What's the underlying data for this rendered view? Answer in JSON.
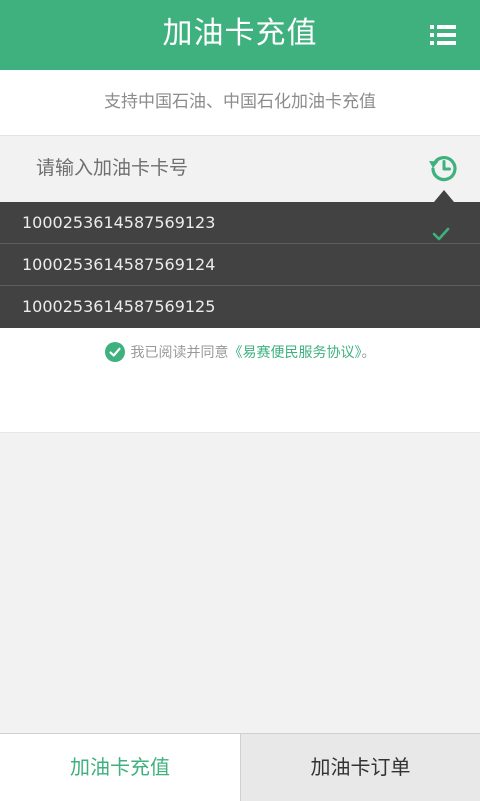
{
  "header": {
    "title": "加油卡充值",
    "menu_icon": "list-icon"
  },
  "notice": "支持中国石油、中国石化加油卡充值",
  "card_input": {
    "placeholder": "请输入加油卡卡号",
    "value": "",
    "history_icon": "history-icon"
  },
  "history": {
    "items": [
      {
        "number": "1000253614587569123",
        "selected": true
      },
      {
        "number": "1000253614587569124",
        "selected": false
      },
      {
        "number": "1000253614587569125",
        "selected": false
      }
    ]
  },
  "agreement": {
    "prefix": "我已阅读并同意",
    "link": "《易赛便民服务协议》",
    "suffix": "。",
    "checked": true
  },
  "tabs": [
    {
      "label": "加油卡充值",
      "active": true
    },
    {
      "label": "加油卡订单",
      "active": false
    }
  ],
  "colors": {
    "accent": "#3fb17f",
    "dropdown_bg": "#424242"
  }
}
